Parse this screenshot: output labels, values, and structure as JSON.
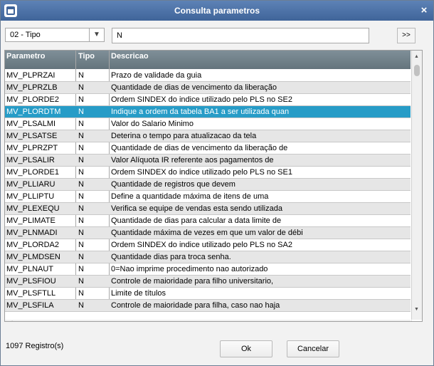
{
  "window": {
    "title": "Consulta parametros",
    "close_symbol": "×"
  },
  "filter": {
    "selected": "02 - Tipo",
    "search_value": "N",
    "go_label": ">>"
  },
  "grid": {
    "columns": [
      "Parametro",
      "Tipo",
      "Descricao"
    ],
    "rows": [
      {
        "p": "MV_PLPRZAI",
        "t": "N",
        "d": "Prazo de validade da guia"
      },
      {
        "p": "MV_PLPRZLB",
        "t": "N",
        "d": "Quantidade de dias de vencimento da liberação"
      },
      {
        "p": "MV_PLORDE2",
        "t": "N",
        "d": "Ordem SINDEX do indice utilizado pelo PLS no SE2"
      },
      {
        "p": "MV_PLORDTM",
        "t": "N",
        "d": "Indique a ordem da tabela BA1 a ser utilizada quan",
        "selected": true
      },
      {
        "p": "MV_PLSALMI",
        "t": "N",
        "d": "Valor do Salario Minimo"
      },
      {
        "p": "MV_PLSATSE",
        "t": "N",
        "d": "Deterina o tempo para atualizacao da tela"
      },
      {
        "p": "MV_PLPRZPT",
        "t": "N",
        "d": "Quantidade de dias de vencimento da liberação de"
      },
      {
        "p": "MV_PLSALIR",
        "t": "N",
        "d": "Valor Alíquota IR referente aos pagamentos de"
      },
      {
        "p": "MV_PLORDE1",
        "t": "N",
        "d": "Ordem SINDEX do indice utilizado pelo PLS no SE1"
      },
      {
        "p": "MV_PLLIARU",
        "t": "N",
        "d": "Quantidade de registros que devem"
      },
      {
        "p": "MV_PLLIPTU",
        "t": "N",
        "d": "Define a quantidade máxima de itens de uma"
      },
      {
        "p": "MV_PLEXEQU",
        "t": "N",
        "d": "Verifica se equipe de vendas esta sendo utilizada"
      },
      {
        "p": "MV_PLIMATE",
        "t": "N",
        "d": "Quantidade de dias para calcular a data limite de"
      },
      {
        "p": "MV_PLNMADI",
        "t": "N",
        "d": "Quantidade máxima de vezes em que um valor de débi"
      },
      {
        "p": "MV_PLORDA2",
        "t": "N",
        "d": "Ordem SINDEX do indice utilizado pelo PLS no SA2"
      },
      {
        "p": "MV_PLMDSEN",
        "t": "N",
        "d": "Quantidade dias para troca senha."
      },
      {
        "p": "MV_PLNAUT",
        "t": "N",
        "d": "0=Nao imprime procedimento nao autorizado"
      },
      {
        "p": "MV_PLSFIOU",
        "t": "N",
        "d": "Controle de maioridade para filho universitario,"
      },
      {
        "p": "MV_PLSFTLL",
        "t": "N",
        "d": "Limite de títulos"
      },
      {
        "p": "MV_PLSFILA",
        "t": "N",
        "d": "Controle de maioridade para filha, caso nao haja"
      }
    ]
  },
  "footer": {
    "record_count": "1097 Registro(s)",
    "ok_label": "Ok",
    "cancel_label": "Cancelar"
  },
  "colors": {
    "titlebar": "#4a6fa5",
    "header": "#6f7f88",
    "selected_row": "#279cc7"
  }
}
